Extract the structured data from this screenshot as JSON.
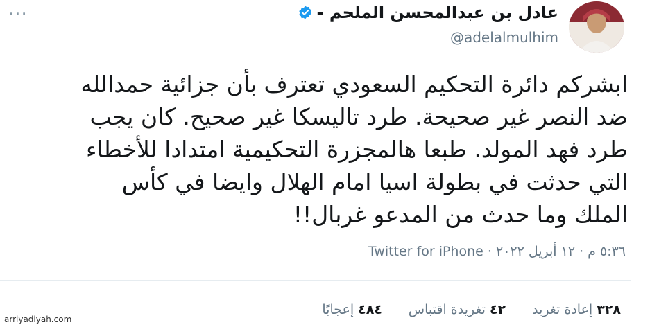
{
  "tweet": {
    "display_name": "عادل بن عبدالمحسن الملحم -",
    "handle": "@adelalmulhim",
    "more_glyph": "···",
    "lines": [
      "ابشركم دائرة التحكيم السعودي تعترف بأن جزائية حمدالله",
      "ضد النصر غير صحيحة. طرد تاليسكا غير صحيح. كان يجب",
      "طرد فهد المولد. طبعا هالمجزرة التحكيمية امتدادا للأخطاء",
      "التي حدثت في بطولة اسيا امام الهلال وايضا في كأس",
      "الملك وما حدث من المدعو غربال!!"
    ],
    "timestamp": "٥:٣٦ م · ١٢ أبريل ٢٠٢٢ ·",
    "source": "Twitter for iPhone",
    "stats": [
      {
        "value": "٣٢٨",
        "label": "إعادة تغريد"
      },
      {
        "value": "٤٢",
        "label": "تغريدة اقتباس"
      },
      {
        "value": "٤٨٤",
        "label": "إعجابًا"
      }
    ]
  },
  "watermark": "arriyadiyah.com",
  "colors": {
    "verified": "#1d9bf0",
    "muted": "#657786",
    "text": "#14171a"
  }
}
